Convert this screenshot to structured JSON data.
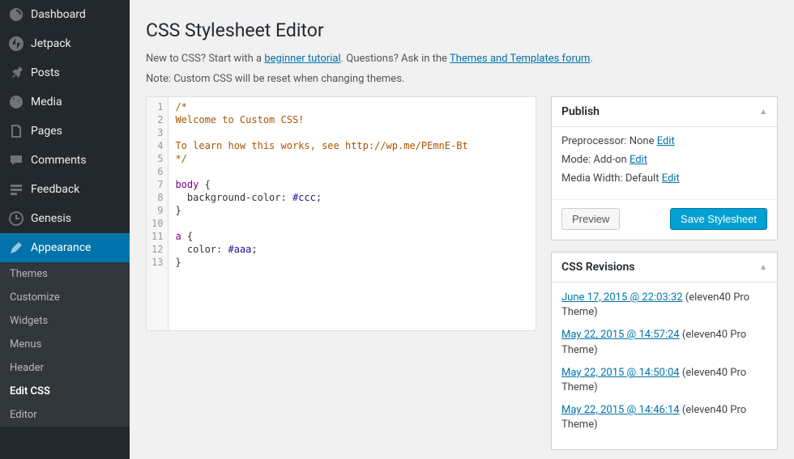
{
  "sidebar": {
    "items": [
      {
        "label": "Dashboard",
        "icon": "dashboard"
      },
      {
        "label": "Jetpack",
        "icon": "jetpack"
      },
      {
        "label": "Posts",
        "icon": "pin"
      },
      {
        "label": "Media",
        "icon": "media"
      },
      {
        "label": "Pages",
        "icon": "pages"
      },
      {
        "label": "Comments",
        "icon": "comments"
      },
      {
        "label": "Feedback",
        "icon": "feedback"
      },
      {
        "label": "Genesis",
        "icon": "genesis"
      },
      {
        "label": "Appearance",
        "icon": "appearance"
      }
    ],
    "submenu": [
      {
        "label": "Themes"
      },
      {
        "label": "Customize"
      },
      {
        "label": "Widgets"
      },
      {
        "label": "Menus"
      },
      {
        "label": "Header"
      },
      {
        "label": "Edit CSS"
      },
      {
        "label": "Editor"
      }
    ]
  },
  "header": {
    "title": "CSS Stylesheet Editor",
    "intro_prefix": "New to CSS? Start with a ",
    "intro_link1": "beginner tutorial",
    "intro_mid": ". Questions? Ask in the ",
    "intro_link2": "Themes and Templates forum",
    "intro_suffix": ".",
    "note": "Note: Custom CSS will be reset when changing themes."
  },
  "editor": {
    "lines": [
      {
        "n": "1",
        "html": "<span class=\"cm-comment\">/*</span>"
      },
      {
        "n": "2",
        "html": "<span class=\"cm-comment\">Welcome to Custom CSS!</span>"
      },
      {
        "n": "3",
        "html": ""
      },
      {
        "n": "4",
        "html": "<span class=\"cm-comment\">To learn how this works, see http://wp.me/PEmnE-Bt</span>"
      },
      {
        "n": "5",
        "html": "<span class=\"cm-comment\">*/</span>"
      },
      {
        "n": "6",
        "html": ""
      },
      {
        "n": "7",
        "html": "<span class=\"cm-keyword\">body</span> {"
      },
      {
        "n": "8",
        "html": "  <span class=\"cm-property\">background-color</span>: <span class=\"cm-atom\">#ccc</span>;"
      },
      {
        "n": "9",
        "html": "}"
      },
      {
        "n": "10",
        "html": ""
      },
      {
        "n": "11",
        "html": "<span class=\"cm-keyword\">a</span> {"
      },
      {
        "n": "12",
        "html": "  <span class=\"cm-property\">color</span>: <span class=\"cm-atom\">#aaa</span>;"
      },
      {
        "n": "13",
        "html": "}"
      }
    ]
  },
  "publish": {
    "title": "Publish",
    "preprocessor_label": "Preprocessor:",
    "preprocessor_value": "None",
    "mode_label": "Mode:",
    "mode_value": "Add-on",
    "media_label": "Media Width:",
    "media_value": "Default",
    "edit_label": "Edit",
    "preview_btn": "Preview",
    "save_btn": "Save Stylesheet"
  },
  "revisions": {
    "title": "CSS Revisions",
    "items": [
      {
        "date": "June 17, 2015 @ 22:03:32",
        "theme": "(eleven40 Pro Theme)"
      },
      {
        "date": "May 22, 2015 @ 14:57:24",
        "theme": "(eleven40 Pro Theme)"
      },
      {
        "date": "May 22, 2015 @ 14:50:04",
        "theme": "(eleven40 Pro Theme)"
      },
      {
        "date": "May 22, 2015 @ 14:46:14",
        "theme": "(eleven40 Pro Theme)"
      }
    ]
  }
}
